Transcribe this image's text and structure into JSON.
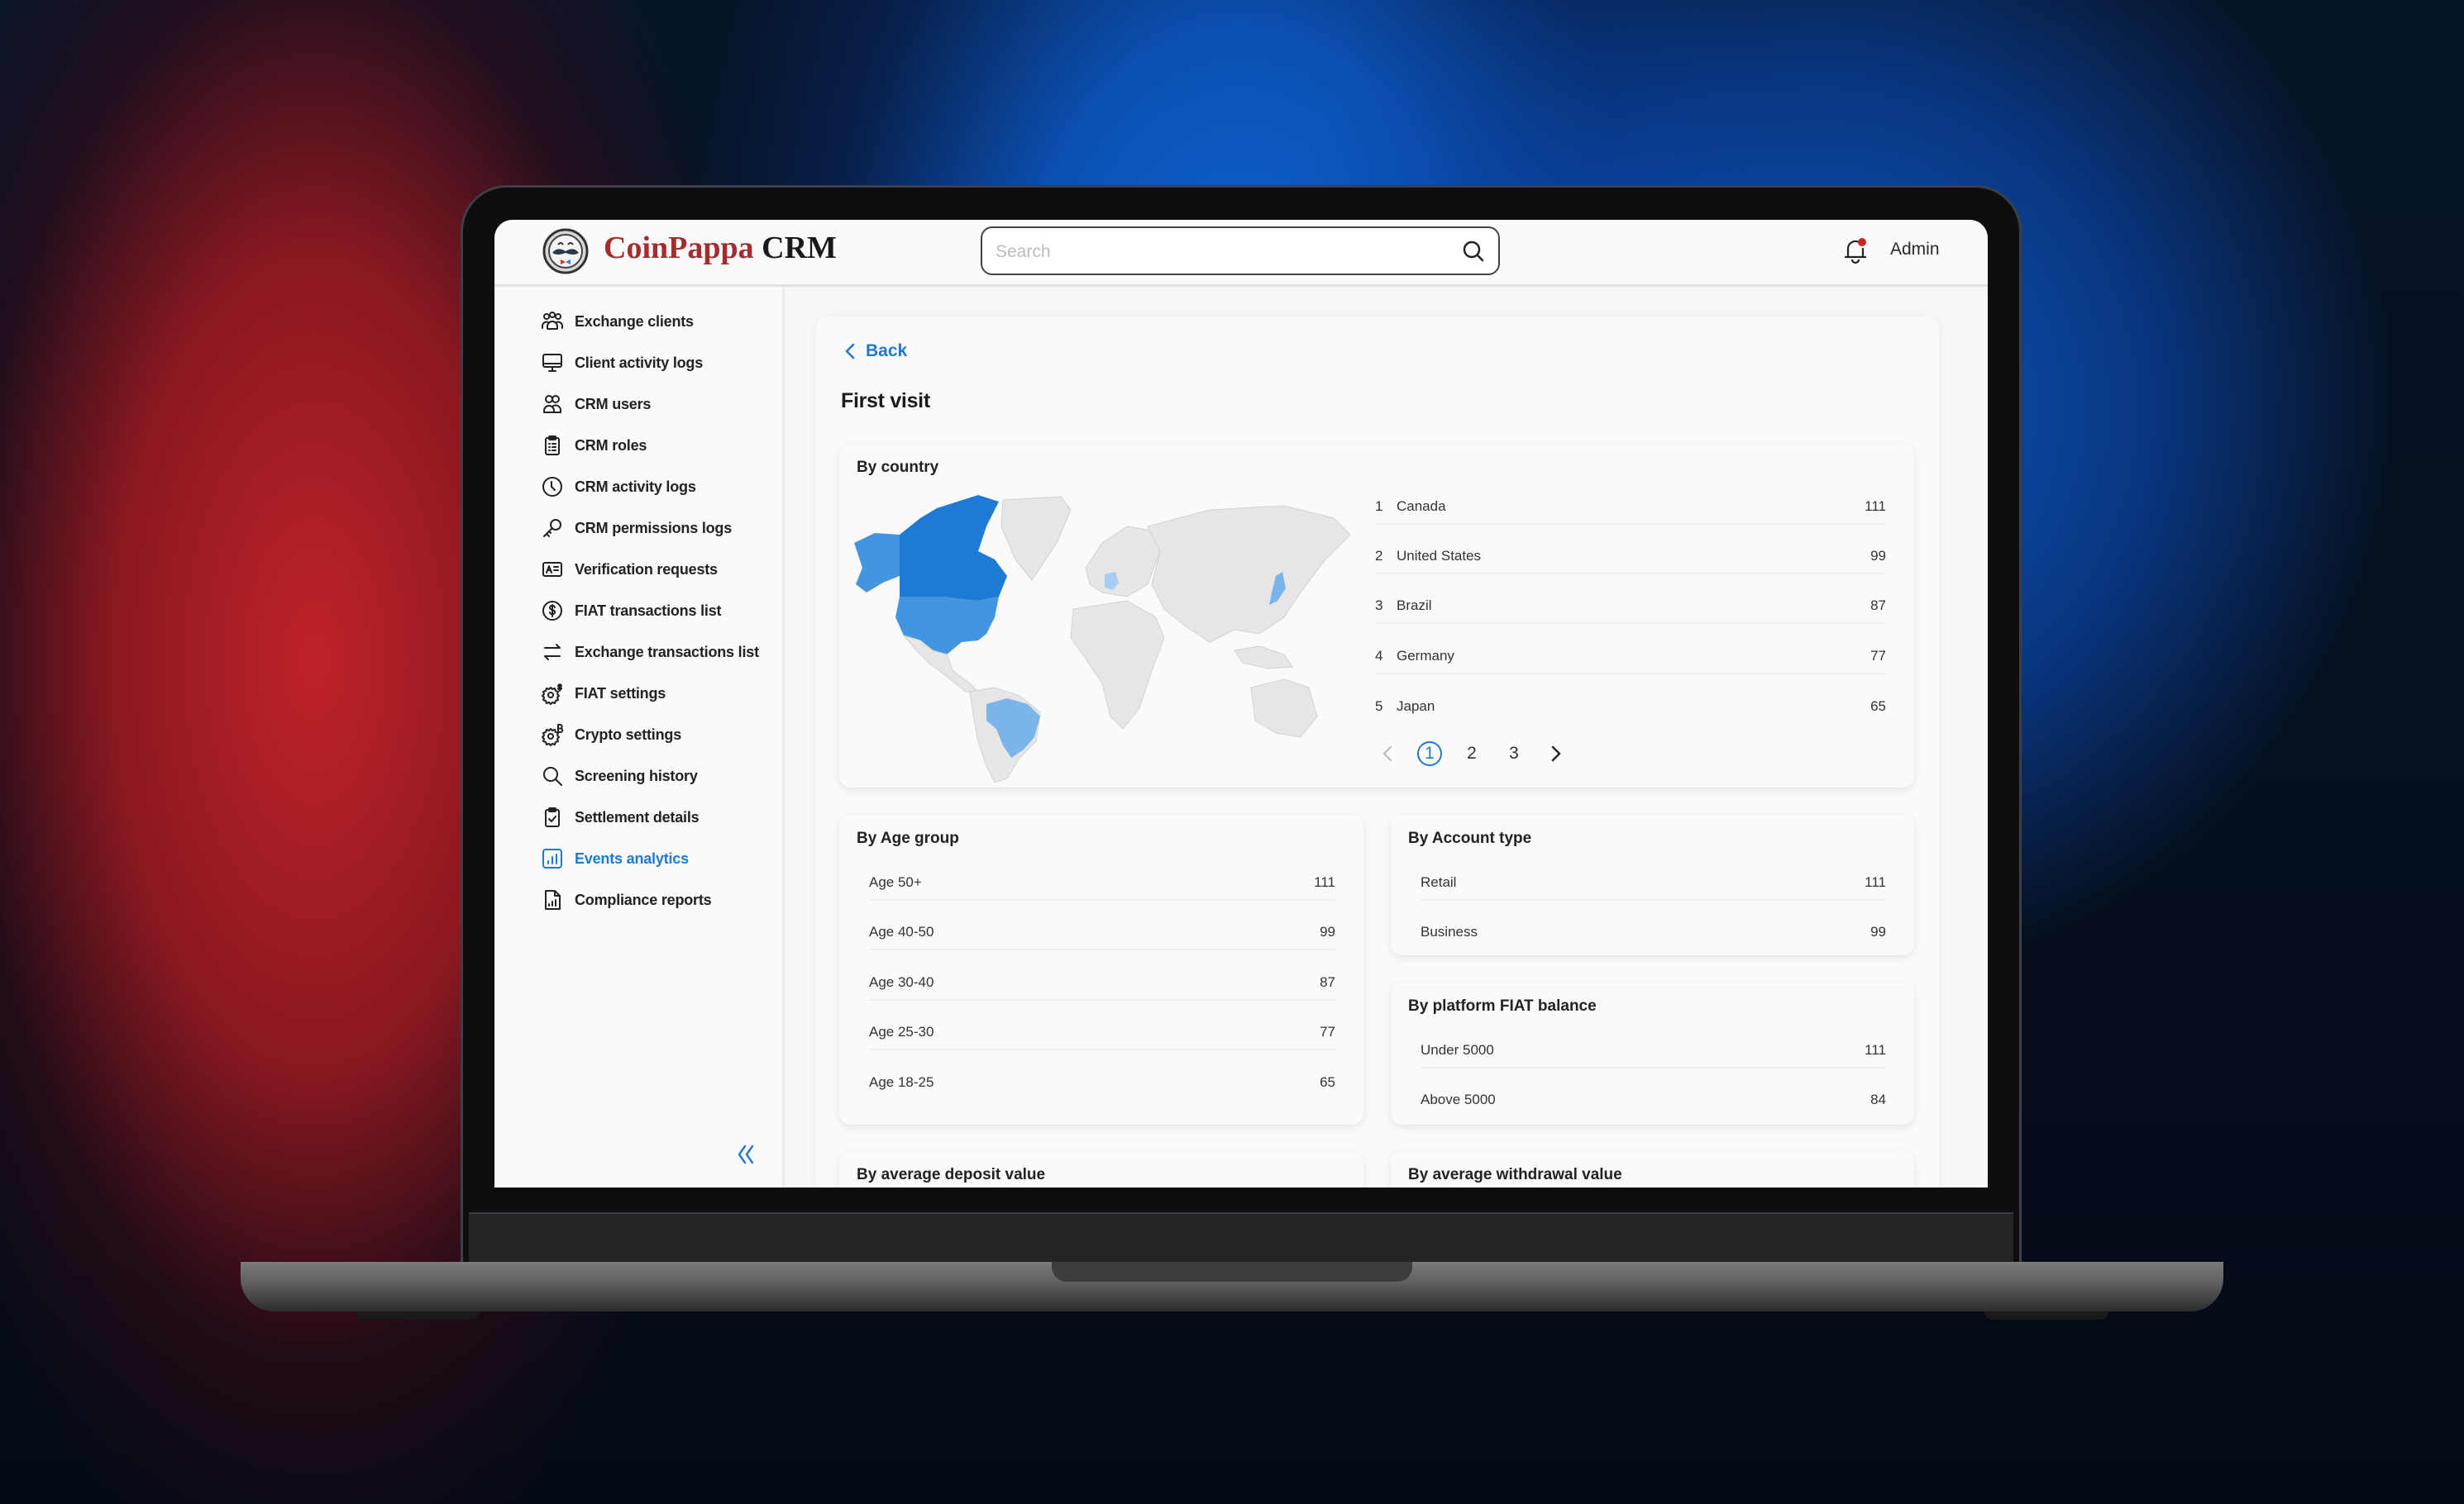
{
  "header": {
    "brand_primary": "CoinPappa",
    "brand_secondary": "CRM",
    "search_placeholder": "Search",
    "user_label": "Admin",
    "has_notification": true
  },
  "sidebar": {
    "items": [
      {
        "label": "Exchange clients",
        "icon": "users-group-icon"
      },
      {
        "label": "Client activity logs",
        "icon": "monitor-icon"
      },
      {
        "label": "CRM users",
        "icon": "users-icon"
      },
      {
        "label": "CRM roles",
        "icon": "clipboard-list-icon"
      },
      {
        "label": "CRM activity logs",
        "icon": "clock-icon"
      },
      {
        "label": "CRM permissions logs",
        "icon": "key-icon"
      },
      {
        "label": "Verification requests",
        "icon": "id-card-icon"
      },
      {
        "label": "FIAT transactions list",
        "icon": "dollar-circle-icon"
      },
      {
        "label": "Exchange transactions list",
        "icon": "arrows-swap-icon"
      },
      {
        "label": "FIAT settings",
        "icon": "gear-dollar-icon"
      },
      {
        "label": "Crypto settings",
        "icon": "gear-bitcoin-icon"
      },
      {
        "label": "Screening history",
        "icon": "search-icon"
      },
      {
        "label": "Settlement details",
        "icon": "clipboard-check-icon"
      },
      {
        "label": "Events analytics",
        "icon": "bar-chart-icon",
        "active": true
      },
      {
        "label": "Compliance reports",
        "icon": "report-file-icon"
      }
    ],
    "active_color": "#1e7bd0"
  },
  "main": {
    "back_label": "Back",
    "title": "First visit",
    "by_country": {
      "title": "By country",
      "rows": [
        {
          "rank": "1",
          "name": "Canada",
          "value": "111"
        },
        {
          "rank": "2",
          "name": "United States",
          "value": "99"
        },
        {
          "rank": "3",
          "name": "Brazil",
          "value": "87"
        },
        {
          "rank": "4",
          "name": "Germany",
          "value": "77"
        },
        {
          "rank": "5",
          "name": "Japan",
          "value": "65"
        }
      ],
      "pagination": {
        "pages": [
          "1",
          "2",
          "3"
        ],
        "current": "1"
      },
      "map_colors": {
        "highest": "#1f7ad6",
        "high": "#4495e0",
        "mid": "#7ab4ea",
        "low": "#a6cdf2",
        "none": "#e6e6e6"
      }
    },
    "by_age_group": {
      "title": "By Age group",
      "rows": [
        {
          "label": "Age 50+",
          "value": "111"
        },
        {
          "label": "Age 40-50",
          "value": "99"
        },
        {
          "label": "Age 30-40",
          "value": "87"
        },
        {
          "label": "Age 25-30",
          "value": "77"
        },
        {
          "label": "Age 18-25",
          "value": "65"
        }
      ]
    },
    "by_account_type": {
      "title": "By Account type",
      "rows": [
        {
          "label": "Retail",
          "value": "111"
        },
        {
          "label": "Business",
          "value": "99"
        }
      ]
    },
    "by_fiat_balance": {
      "title": "By platform FIAT balance",
      "rows": [
        {
          "label": "Under 5000",
          "value": "111"
        },
        {
          "label": "Above 5000",
          "value": "84"
        }
      ]
    },
    "by_avg_deposit": {
      "title": "By average deposit value"
    },
    "by_avg_withdrawal": {
      "title": "By average withdrawal value"
    }
  }
}
